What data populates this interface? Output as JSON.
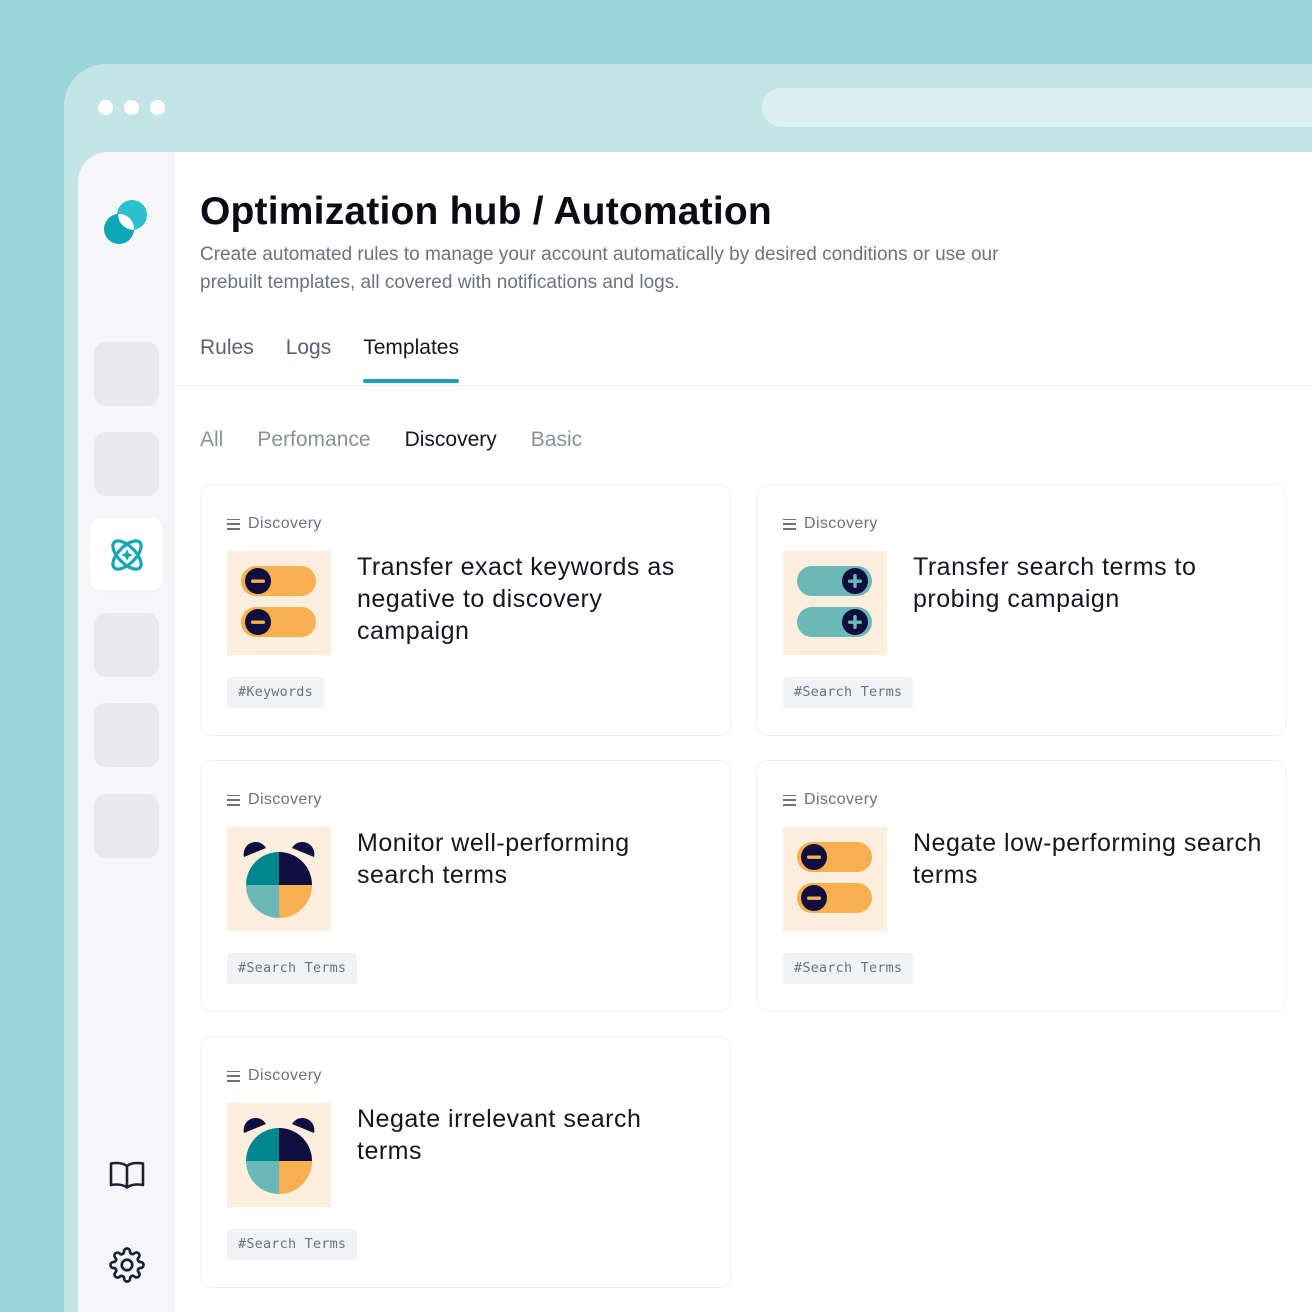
{
  "header": {
    "title": "Optimization hub / Automation",
    "description": "Create automated rules to manage your account automatically by desired conditions or use our prebuilt templates, all covered with notifications and logs."
  },
  "tabs": [
    {
      "label": "Rules",
      "active": false
    },
    {
      "label": "Logs",
      "active": false
    },
    {
      "label": "Templates",
      "active": true
    }
  ],
  "filters": [
    {
      "label": "All",
      "active": false
    },
    {
      "label": "Perfomance",
      "active": false
    },
    {
      "label": "Discovery",
      "active": true
    },
    {
      "label": "Basic",
      "active": false
    }
  ],
  "cards": [
    {
      "category": "Discovery",
      "title": "Transfer exact keywords as negative to discovery campaign",
      "tag": "#Keywords",
      "icon": "minus-toggles-icon"
    },
    {
      "category": "Discovery",
      "title": "Transfer search terms to probing campaign",
      "tag": "#Search Terms",
      "icon": "plus-toggles-icon"
    },
    {
      "category": "Discovery",
      "title": "Monitor well-performing search terms",
      "tag": "#Search Terms",
      "icon": "alarm-clock-icon"
    },
    {
      "category": "Discovery",
      "title": "Negate low-performing search terms",
      "tag": "#Search Terms",
      "icon": "minus-toggles-icon"
    },
    {
      "category": "Discovery",
      "title": "Negate irrelevant search terms",
      "tag": "#Search Terms",
      "icon": "alarm-clock-icon"
    }
  ],
  "sidebar": {
    "logo": "brand-logo-icon",
    "active_item_icon": "automation-atom-icon",
    "bottom_icons": [
      "book-icon",
      "gear-icon"
    ]
  },
  "colors": {
    "background": "#9ad5da",
    "accent": "#1aa3b0",
    "orange": "#f6b04f",
    "teal": "#6ab8b7",
    "navy": "#0f0e3e",
    "thumb_bg": "#fbeedd"
  }
}
